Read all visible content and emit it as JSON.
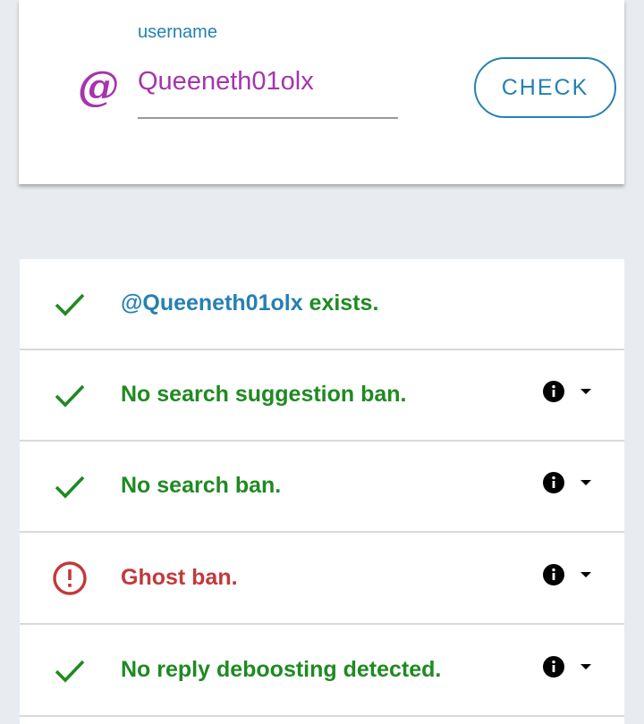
{
  "input": {
    "label": "username",
    "value": "Queeneth01olx",
    "at_symbol": "@"
  },
  "check_button": {
    "label": "CHECK"
  },
  "results": [
    {
      "status": "ok",
      "handle": "@Queeneth01olx",
      "text": " exists.",
      "has_details": false
    },
    {
      "status": "ok",
      "text": "No search suggestion ban.",
      "has_details": true
    },
    {
      "status": "ok",
      "text": "No search ban.",
      "has_details": true
    },
    {
      "status": "error",
      "text": "Ghost ban.",
      "has_details": true
    },
    {
      "status": "ok",
      "text": "No reply deboosting detected.",
      "has_details": true
    }
  ],
  "colors": {
    "accent": "#2580b4",
    "handle_purple": "#a634ad",
    "ok_green": "#1f8a22",
    "error_red": "#c2393b",
    "background": "#e8ecf0"
  },
  "icons": {
    "ok": "check-icon",
    "error": "alert-circle-icon",
    "info": "info-icon",
    "expand": "caret-down-icon",
    "input": "at-icon"
  }
}
